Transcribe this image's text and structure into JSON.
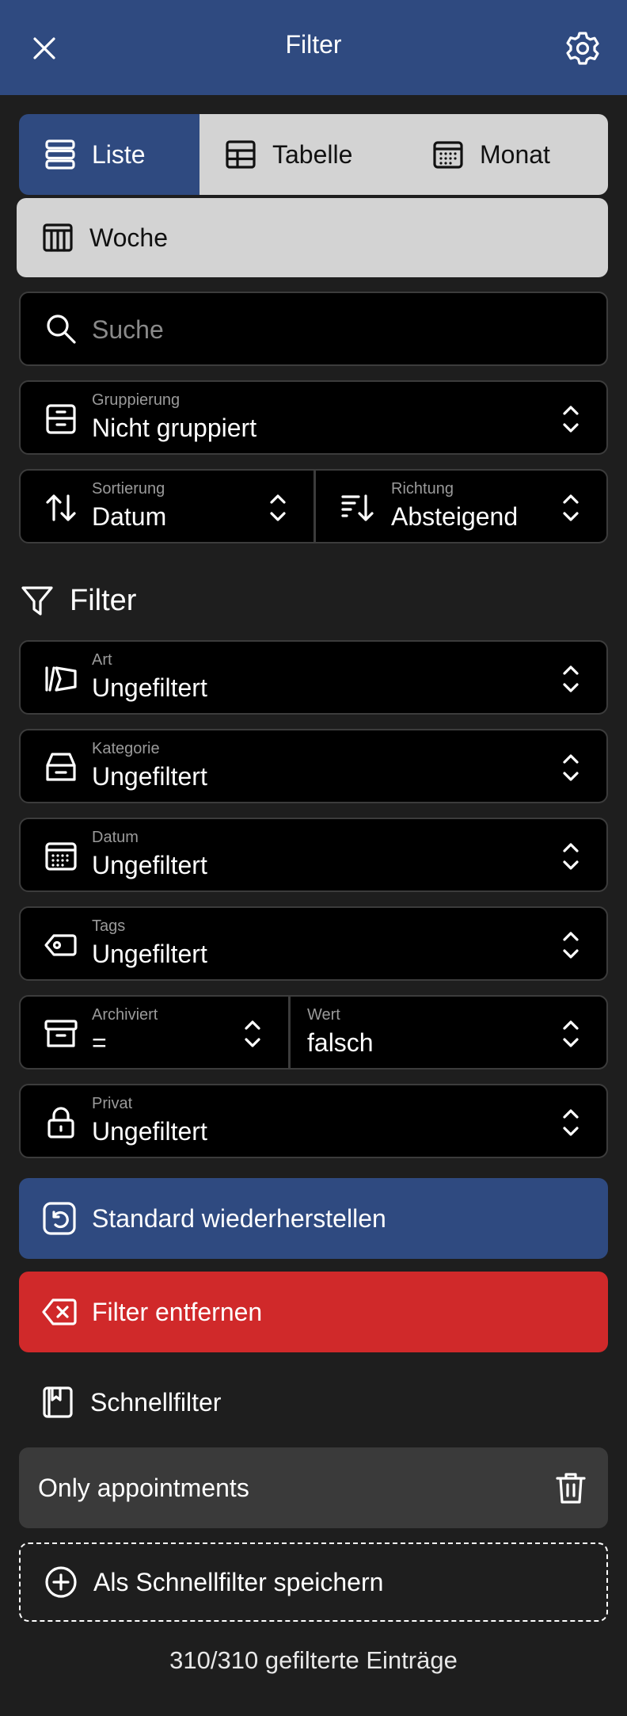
{
  "header": {
    "title": "Filter"
  },
  "views": {
    "liste": "Liste",
    "tabelle": "Tabelle",
    "monat": "Monat",
    "woche": "Woche"
  },
  "search": {
    "placeholder": "Suche"
  },
  "grouping": {
    "label": "Gruppierung",
    "value": "Nicht gruppiert"
  },
  "sorting": {
    "label": "Sortierung",
    "value": "Datum"
  },
  "direction": {
    "label": "Richtung",
    "value": "Absteigend"
  },
  "filter_section": {
    "title": "Filter",
    "art": {
      "label": "Art",
      "value": "Ungefiltert"
    },
    "kategorie": {
      "label": "Kategorie",
      "value": "Ungefiltert"
    },
    "datum": {
      "label": "Datum",
      "value": "Ungefiltert"
    },
    "tags": {
      "label": "Tags",
      "value": "Ungefiltert"
    },
    "archiviert": {
      "label": "Archiviert",
      "value": "="
    },
    "wert": {
      "label": "Wert",
      "value": "falsch"
    },
    "privat": {
      "label": "Privat",
      "value": "Ungefiltert"
    }
  },
  "actions": {
    "restore": "Standard wiederherstellen",
    "remove": "Filter entfernen"
  },
  "quick_filters": {
    "title": "Schnellfilter",
    "items": [
      {
        "label": "Only appointments"
      }
    ],
    "save_label": "Als Schnellfilter speichern"
  },
  "footer": {
    "count": "310/310 gefilterte Einträge"
  },
  "colors": {
    "accent": "#2f4a80",
    "danger": "#d0292a",
    "tab_inactive": "#d3d3d3",
    "background": "#1e1e1e"
  }
}
